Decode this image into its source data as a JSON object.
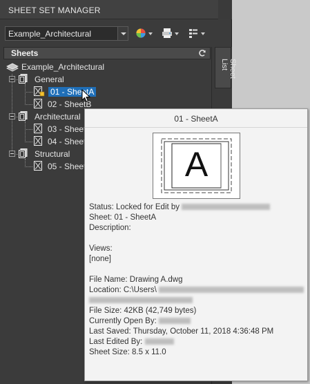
{
  "window": {
    "title": "SHEET SET MANAGER"
  },
  "toolbar": {
    "sheet_set_value": "Example_Architectural",
    "buttons": [
      {
        "icon": "sheet-set-icon"
      },
      {
        "icon": "publish-icon"
      },
      {
        "icon": "sheet-list-icon"
      }
    ]
  },
  "sheets_panel": {
    "header": "Sheets",
    "refresh_icon": "refresh-icon"
  },
  "tree": {
    "root": "Example_Architectural",
    "items": [
      {
        "label": "General"
      },
      {
        "label": "01 - SheetA"
      },
      {
        "label": "02 - SheetB"
      },
      {
        "label": "Architectural"
      },
      {
        "label": "03 - Sheet"
      },
      {
        "label": "04 - Sheet"
      },
      {
        "label": "Structural"
      },
      {
        "label": "05 - Sheet"
      }
    ]
  },
  "side_tab": {
    "label": "Sheet List"
  },
  "tooltip": {
    "title": "01 - SheetA",
    "thumbnail_letter": "A",
    "status": "Status: Locked for Edit by",
    "sheet": "Sheet: 01 - SheetA",
    "description": "Description:",
    "views_label": "Views:",
    "views_value": "[none]",
    "file_name": "File Name: Drawing A.dwg",
    "location": "Location: C:\\Users\\",
    "file_size": "File Size: 42KB (42,749 bytes)",
    "currently_open_by": "Currently Open By:",
    "last_saved": "Last Saved: Thursday, October 11, 2018  4:36:48 PM",
    "last_edited_by": "Last Edited By:",
    "sheet_size": "Sheet Size: 8.5 x 11.0"
  },
  "colors": {
    "selection": "#1f6fb8",
    "panel_bg": "#3b3b3b",
    "tooltip_bg": "#f3f3f3"
  }
}
